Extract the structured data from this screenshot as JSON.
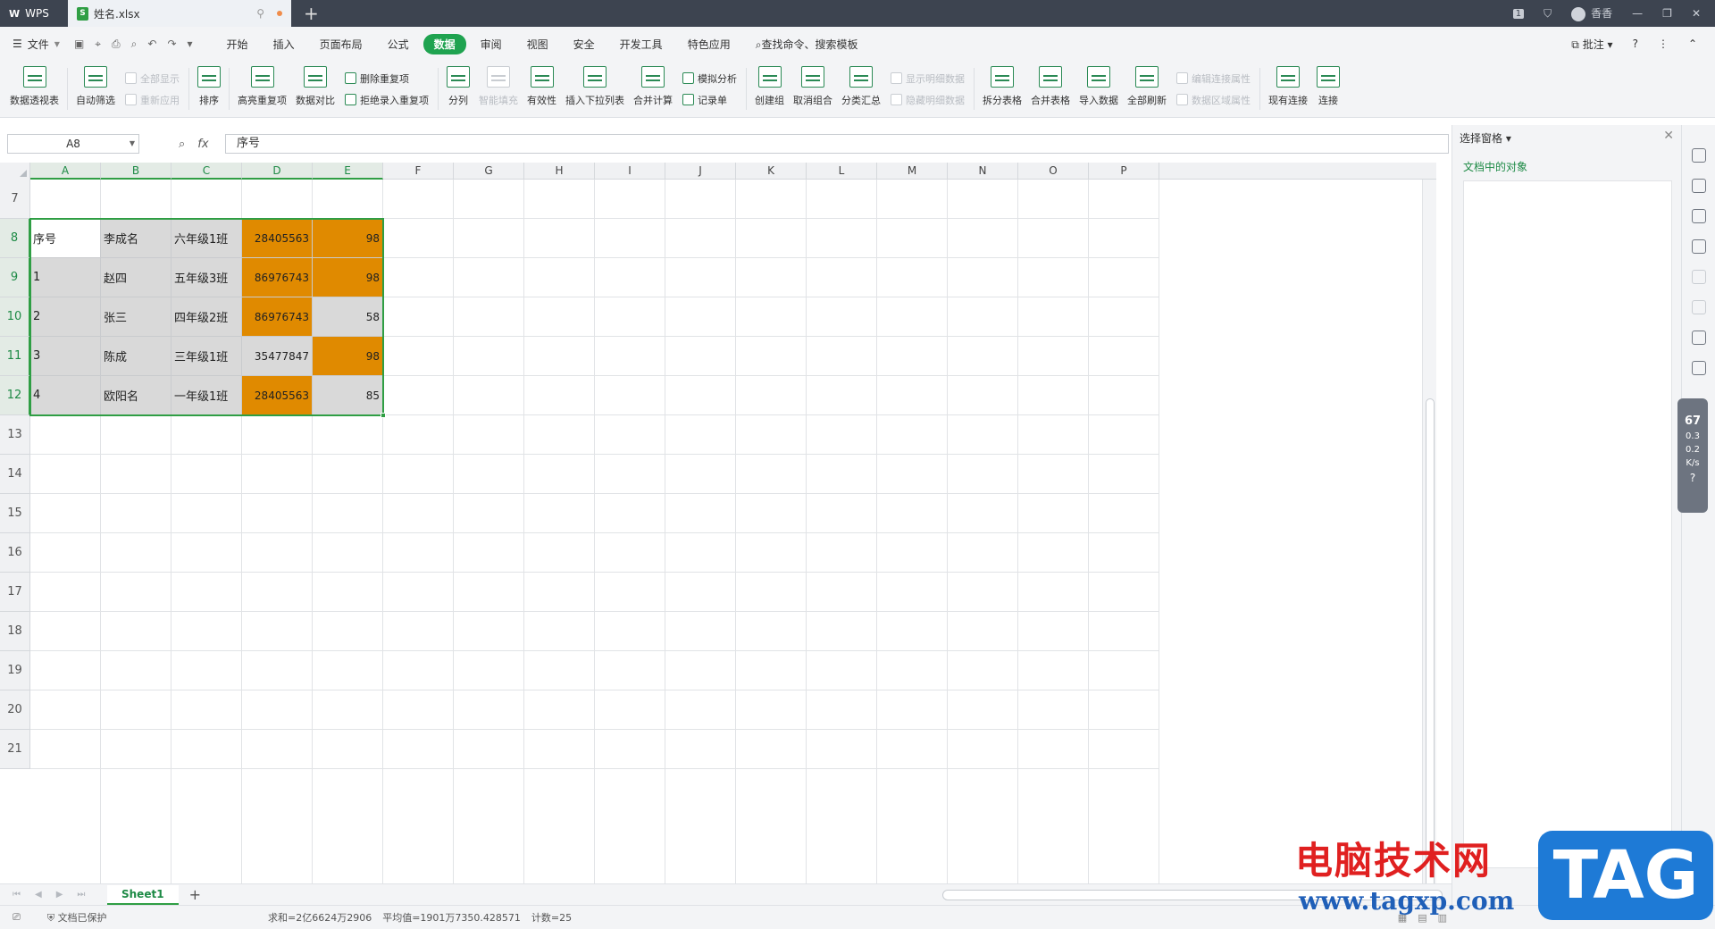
{
  "titlebar": {
    "app_tab": "WPS",
    "doc_tab": "姓名.xlsx",
    "badge": "1",
    "user": "香香"
  },
  "menu": {
    "file": "文件",
    "items": [
      "开始",
      "插入",
      "页面布局",
      "公式",
      "数据",
      "审阅",
      "视图",
      "安全",
      "开发工具",
      "特色应用"
    ],
    "active": "数据",
    "search": "查找命令、搜索模板",
    "comment": "批注",
    "help": "?"
  },
  "ribbon": {
    "pivot": "数据透视表",
    "autofilter": "自动筛选",
    "show_all": "全部显示",
    "reapply": "重新应用",
    "sort": "排序",
    "highlight_dup": "高亮重复项",
    "data_compare": "数据对比",
    "remove_dup": "删除重复项",
    "reject_dup": "拒绝录入重复项",
    "split_col": "分列",
    "smart_fill": "智能填充",
    "validity": "有效性",
    "insert_dropdown": "插入下拉列表",
    "consolidate": "合并计算",
    "simulate": "模拟分析",
    "record": "记录单",
    "create_group": "创建组",
    "ungroup": "取消组合",
    "subtotal": "分类汇总",
    "show_detail": "显示明细数据",
    "hide_detail": "隐藏明细数据",
    "split_table": "拆分表格",
    "merge_table": "合并表格",
    "import_data": "导入数据",
    "refresh_all": "全部刷新",
    "edit_conn": "编辑连接属性",
    "range_props": "数据区域属性",
    "existing_conn": "现有连接",
    "connect": "连接"
  },
  "formula_bar": {
    "name_box": "A8",
    "fx": "fx",
    "content": "序号"
  },
  "columns": [
    "A",
    "B",
    "C",
    "D",
    "E",
    "F",
    "G",
    "H",
    "I",
    "J",
    "K",
    "L",
    "M",
    "N",
    "O",
    "P"
  ],
  "rows": [
    "7",
    "8",
    "9",
    "10",
    "11",
    "12",
    "13",
    "14",
    "15",
    "16",
    "17",
    "18",
    "19",
    "20",
    "21"
  ],
  "table": [
    {
      "a": "序号",
      "b": "李成名",
      "c": "六年级1班",
      "d": "28405563",
      "e": "98"
    },
    {
      "a": "1",
      "b": "赵四",
      "c": "五年级3班",
      "d": "86976743",
      "e": "98"
    },
    {
      "a": "2",
      "b": "张三",
      "c": "四年级2班",
      "d": "86976743",
      "e": "58"
    },
    {
      "a": "3",
      "b": "陈成",
      "c": "三年级1班",
      "d": "35477847",
      "e": "98"
    },
    {
      "a": "4",
      "b": "欧阳名",
      "c": "一年级1班",
      "d": "28405563",
      "e": "85"
    }
  ],
  "colors": {
    "accent": "#2f9e44",
    "highlight": "#e08a00",
    "gray_fill": "#d9d9d9"
  },
  "sheet": {
    "tab": "Sheet1",
    "add": "+"
  },
  "status": {
    "protect": "文档已保护",
    "sum": "求和=2亿6624万2906",
    "avg": "平均值=1901万7350.428571",
    "count": "计数=25"
  },
  "panel": {
    "title": "选择窗格",
    "subtitle": "文档中的对象"
  },
  "perf": {
    "cpu": "67",
    "up": "0.3",
    "down": "0.2",
    "unit": "K/s"
  },
  "watermark": {
    "cn": "电脑技术网",
    "url": "www.tagxp.com",
    "tag": "TAG"
  }
}
